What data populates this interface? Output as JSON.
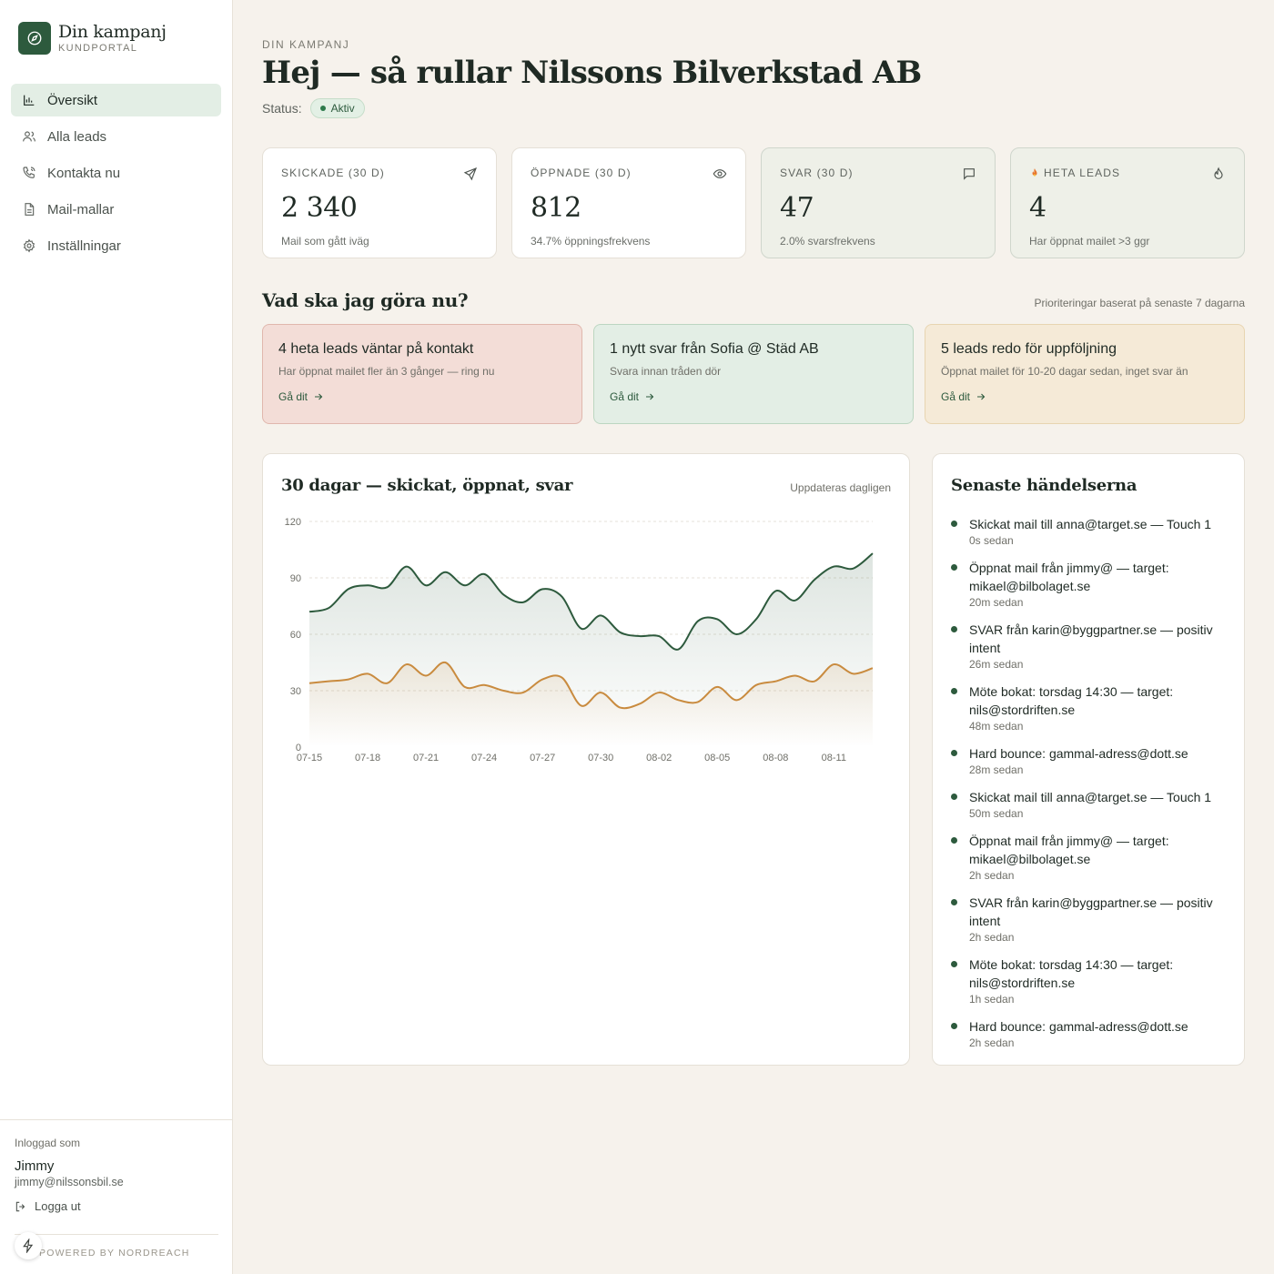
{
  "brand": {
    "title": "Din kampanj",
    "subtitle": "KUNDPORTAL"
  },
  "nav": {
    "items": [
      {
        "label": "Översikt",
        "icon": "bar-chart-icon",
        "active": true
      },
      {
        "label": "Alla leads",
        "icon": "users-icon"
      },
      {
        "label": "Kontakta nu",
        "icon": "phone-icon"
      },
      {
        "label": "Mail-mallar",
        "icon": "document-icon"
      },
      {
        "label": "Inställningar",
        "icon": "gear-icon"
      }
    ]
  },
  "footer": {
    "logged_in_label": "Inloggad som",
    "user_name": "Jimmy",
    "user_email": "jimmy@nilssonsbil.se",
    "logout_label": "Logga ut",
    "powered_by": "POWERED BY NORDREACH"
  },
  "header": {
    "eyebrow": "DIN KAMPANJ",
    "title": "Hej — så rullar Nilssons Bilverkstad AB",
    "status_label": "Status:",
    "status_value": "Aktiv"
  },
  "kpis": [
    {
      "label": "SKICKADE (30 D)",
      "value": "2 340",
      "sub": "Mail som gått iväg",
      "icon": "send-icon"
    },
    {
      "label": "ÖPPNADE (30 D)",
      "value": "812",
      "sub": "34.7% öppningsfrekvens",
      "icon": "eye-icon"
    },
    {
      "label": "SVAR (30 D)",
      "value": "47",
      "sub": "2.0% svarsfrekvens",
      "icon": "message-icon"
    },
    {
      "label": "HETA LEADS",
      "value": "4",
      "sub": "Har öppnat mailet >3 ggr",
      "icon": "flame-icon"
    }
  ],
  "todo": {
    "title": "Vad ska jag göra nu?",
    "note": "Prioriteringar baserat på senaste 7 dagarna",
    "cards": [
      {
        "title": "4 heta leads väntar på kontakt",
        "desc": "Har öppnat mailet fler än 3 gånger — ring nu",
        "link": "Gå dit",
        "tone": "red"
      },
      {
        "title": "1 nytt svar från Sofia @ Städ AB",
        "desc": "Svara innan tråden dör",
        "link": "Gå dit",
        "tone": "green"
      },
      {
        "title": "5 leads redo för uppföljning",
        "desc": "Öppnat mailet för 10-20 dagar sedan, inget svar än",
        "link": "Gå dit",
        "tone": "yellow"
      }
    ]
  },
  "chart": {
    "title": "30 dagar — skickat, öppnat, svar",
    "note": "Uppdateras dagligen"
  },
  "chart_data": {
    "type": "area",
    "title": "30 dagar — skickat, öppnat, svar",
    "x": [
      "07-15",
      "07-16",
      "07-17",
      "07-18",
      "07-19",
      "07-20",
      "07-21",
      "07-22",
      "07-23",
      "07-24",
      "07-25",
      "07-26",
      "07-27",
      "07-28",
      "07-29",
      "07-30",
      "07-31",
      "08-01",
      "08-02",
      "08-03",
      "08-04",
      "08-05",
      "08-06",
      "08-07",
      "08-08",
      "08-09",
      "08-10",
      "08-11",
      "08-12",
      "08-13"
    ],
    "x_ticks": [
      "07-15",
      "07-18",
      "07-21",
      "07-24",
      "07-27",
      "07-30",
      "08-02",
      "08-05",
      "08-08",
      "08-11"
    ],
    "series": [
      {
        "values": [
          72,
          74,
          84,
          86,
          85,
          96,
          86,
          93,
          86,
          92,
          81,
          77,
          84,
          80,
          63,
          70,
          61,
          59,
          59,
          52,
          67,
          68,
          60,
          68,
          83,
          78,
          89,
          96,
          95,
          103
        ],
        "color": "#2d5a3d"
      },
      {
        "values": [
          34,
          35,
          36,
          39,
          34,
          44,
          38,
          45,
          32,
          33,
          30,
          29,
          36,
          37,
          22,
          29,
          21,
          23,
          29,
          25,
          24,
          32,
          25,
          33,
          35,
          38,
          35,
          44,
          39,
          42
        ],
        "color": "#c98b3f"
      }
    ],
    "ylim": [
      0,
      120
    ],
    "y_ticks": [
      0,
      30,
      60,
      90,
      120
    ],
    "grid": true
  },
  "events": {
    "title": "Senaste händelserna",
    "items": [
      {
        "text": "Skickat mail till anna@target.se — Touch 1",
        "time": "0s sedan"
      },
      {
        "text": "Öppnat mail från jimmy@ — target: mikael@bilbolaget.se",
        "time": "20m sedan"
      },
      {
        "text": "SVAR från karin@byggpartner.se — positiv intent",
        "time": "26m sedan"
      },
      {
        "text": "Möte bokat: torsdag 14:30 — target: nils@stordriften.se",
        "time": "48m sedan"
      },
      {
        "text": "Hard bounce: gammal-adress@dott.se",
        "time": "28m sedan"
      },
      {
        "text": "Skickat mail till anna@target.se — Touch 1",
        "time": "50m sedan"
      },
      {
        "text": "Öppnat mail från jimmy@ — target: mikael@bilbolaget.se",
        "time": "2h sedan"
      },
      {
        "text": "SVAR från karin@byggpartner.se — positiv intent",
        "time": "2h sedan"
      },
      {
        "text": "Möte bokat: torsdag 14:30 — target: nils@stordriften.se",
        "time": "1h sedan"
      },
      {
        "text": "Hard bounce: gammal-adress@dott.se",
        "time": "2h sedan"
      }
    ]
  },
  "colors": {
    "accent": "#2d5a3d",
    "secondary": "#c98b3f",
    "background": "#f6f2ec"
  }
}
